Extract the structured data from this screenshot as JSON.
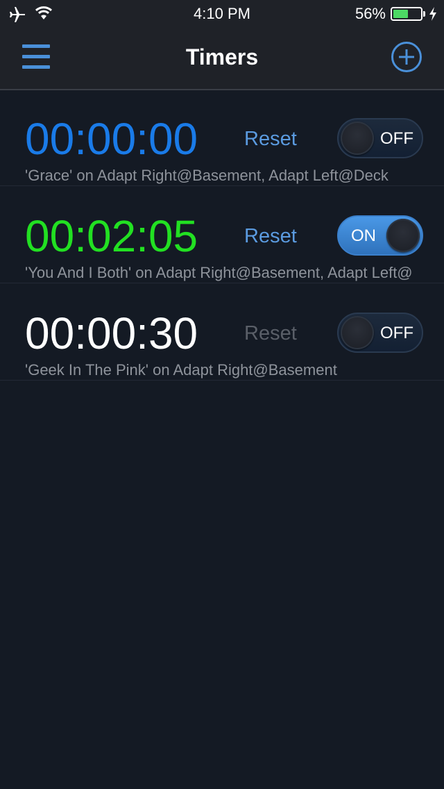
{
  "status_bar": {
    "time": "4:10 PM",
    "battery_percent": "56%",
    "battery_level": 0.56,
    "battery_color": "#4cd964",
    "icons": [
      "airplane-icon",
      "wifi-icon",
      "charging-bolt-icon"
    ]
  },
  "nav": {
    "title": "Timers",
    "menu_icon": "hamburger-menu-icon",
    "add_icon": "plus-circle-icon",
    "accent_color": "#4a90d9"
  },
  "timers": [
    {
      "time": "00:00:00",
      "time_color": "#1a7be8",
      "reset_label": "Reset",
      "reset_enabled": true,
      "toggle_state": "OFF",
      "description": "'Grace' on Adapt Right@Basement, Adapt Left@Deck"
    },
    {
      "time": "00:02:05",
      "time_color": "#22e022",
      "reset_label": "Reset",
      "reset_enabled": true,
      "toggle_state": "ON",
      "description": "'You And I Both' on Adapt Right@Basement, Adapt Left@"
    },
    {
      "time": "00:00:30",
      "time_color": "#ffffff",
      "reset_label": "Reset",
      "reset_enabled": false,
      "toggle_state": "OFF",
      "description": "'Geek In The Pink' on Adapt Right@Basement"
    }
  ]
}
